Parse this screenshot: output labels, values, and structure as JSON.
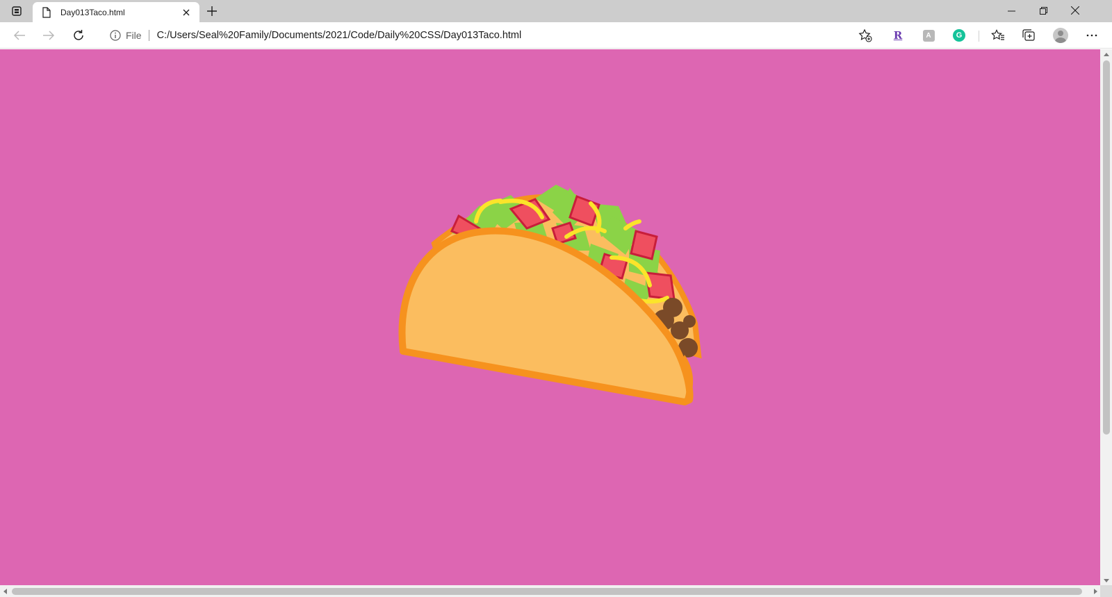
{
  "browser": {
    "tab": {
      "title": "Day013Taco.html"
    },
    "omnibox": {
      "scheme_label": "File",
      "url": "C:/Users/Seal%20Family/Documents/2021/Code/Daily%20CSS/Day013Taco.html"
    },
    "extensions": [
      {
        "name": "r-extension-icon",
        "glyph": "R"
      },
      {
        "name": "puzzle-extension-icon",
        "glyph": "A"
      },
      {
        "name": "grammarly-icon",
        "glyph": "G"
      }
    ]
  },
  "page": {
    "background_color": "#dd66b2",
    "illustration": {
      "subject": "taco",
      "colors": {
        "shell": "#fbbd5f",
        "shell_outline": "#f6921e",
        "lettuce": "#8bd347",
        "tomato": "#ef4f5f",
        "tomato_outline": "#c81e3a",
        "cheese": "#fbe42a",
        "meat": "#7a4a28"
      }
    }
  }
}
